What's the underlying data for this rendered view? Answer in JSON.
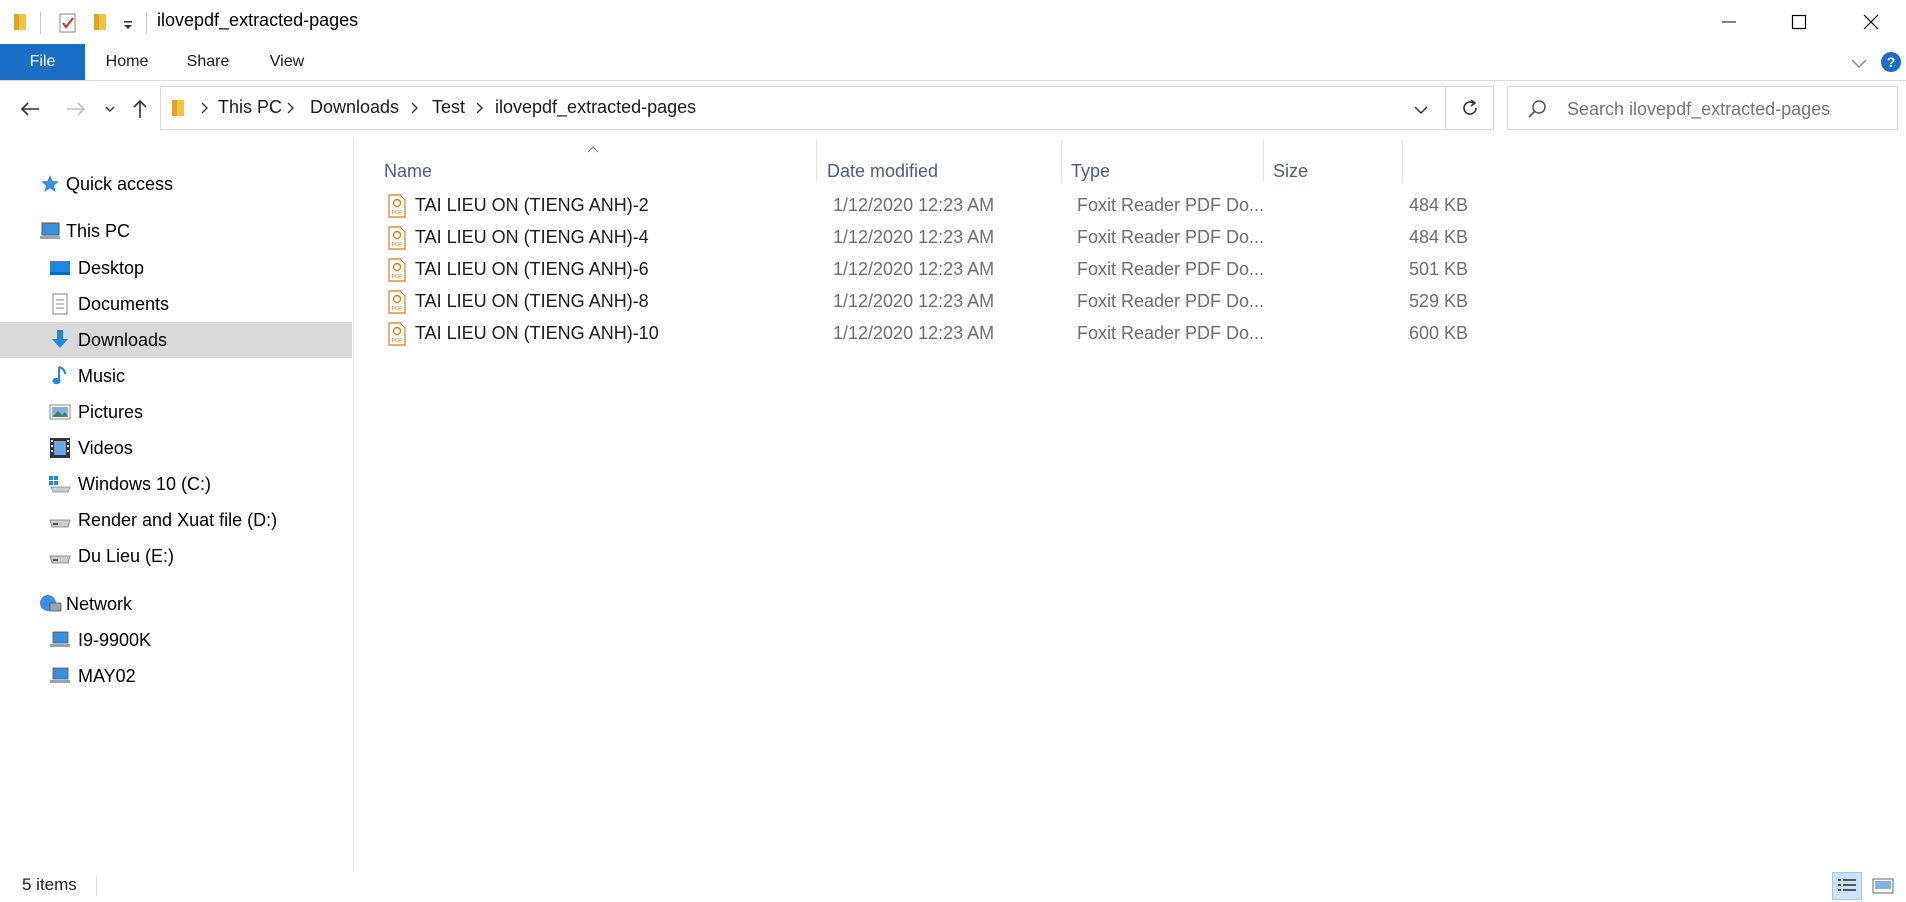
{
  "window": {
    "title": "ilovepdf_extracted-pages"
  },
  "ribbon": {
    "tabs": [
      "File",
      "Home",
      "Share",
      "View"
    ],
    "accent": "#1a6fc4"
  },
  "address": {
    "crumbs": [
      "This PC",
      "Downloads",
      "Test",
      "ilovepdf_extracted-pages"
    ]
  },
  "search": {
    "placeholder": "Search ilovepdf_extracted-pages"
  },
  "nav": {
    "items": [
      {
        "label": "Quick access",
        "icon": "star-icon"
      },
      {
        "label": "This PC",
        "icon": "computer-icon"
      },
      {
        "label": "Desktop",
        "icon": "desktop-icon"
      },
      {
        "label": "Documents",
        "icon": "documents-icon"
      },
      {
        "label": "Downloads",
        "icon": "download-icon",
        "selected": true
      },
      {
        "label": "Music",
        "icon": "music-icon"
      },
      {
        "label": "Pictures",
        "icon": "pictures-icon"
      },
      {
        "label": "Videos",
        "icon": "videos-icon"
      },
      {
        "label": "Windows 10 (C:)",
        "icon": "drive-windows-icon"
      },
      {
        "label": "Render and Xuat file (D:)",
        "icon": "drive-icon"
      },
      {
        "label": "Du Lieu (E:)",
        "icon": "drive-icon"
      },
      {
        "label": "Network",
        "icon": "network-icon"
      },
      {
        "label": "I9-9900K",
        "icon": "network-computer-icon"
      },
      {
        "label": "MAY02",
        "icon": "network-computer-icon"
      }
    ]
  },
  "filelist": {
    "columns": {
      "name": "Name",
      "date": "Date modified",
      "type": "Type",
      "size": "Size"
    },
    "rows": [
      {
        "name": "TAI LIEU ON (TIENG ANH)-2",
        "date": "1/12/2020 12:23 AM",
        "type": "Foxit Reader PDF Do...",
        "size": "484 KB"
      },
      {
        "name": "TAI LIEU ON (TIENG ANH)-4",
        "date": "1/12/2020 12:23 AM",
        "type": "Foxit Reader PDF Do...",
        "size": "484 KB"
      },
      {
        "name": "TAI LIEU ON (TIENG ANH)-6",
        "date": "1/12/2020 12:23 AM",
        "type": "Foxit Reader PDF Do...",
        "size": "501 KB"
      },
      {
        "name": "TAI LIEU ON (TIENG ANH)-8",
        "date": "1/12/2020 12:23 AM",
        "type": "Foxit Reader PDF Do...",
        "size": "529 KB"
      },
      {
        "name": "TAI LIEU ON (TIENG ANH)-10",
        "date": "1/12/2020 12:23 AM",
        "type": "Foxit Reader PDF Do...",
        "size": "600 KB"
      }
    ]
  },
  "status": {
    "count": "5 items"
  }
}
